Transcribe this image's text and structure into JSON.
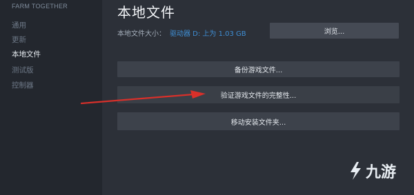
{
  "sidebar": {
    "game_title": "FARM TOGETHER",
    "items": [
      {
        "label": "通用",
        "active": false
      },
      {
        "label": "更新",
        "active": false
      },
      {
        "label": "本地文件",
        "active": true
      },
      {
        "label": "测试版",
        "active": false
      },
      {
        "label": "控制器",
        "active": false
      }
    ]
  },
  "main": {
    "title": "本地文件",
    "size_label": "本地文件大小：",
    "size_value": "驱动器 D: 上为 1.03 GB",
    "browse_label": "浏览...",
    "backup_label": "备份游戏文件...",
    "verify_label": "验证游戏文件的完整性...",
    "move_label": "移动安装文件夹..."
  },
  "watermark": {
    "text": "九游"
  },
  "colors": {
    "arrow": "#d9302a",
    "accent_blue": "#3f8fd6"
  }
}
